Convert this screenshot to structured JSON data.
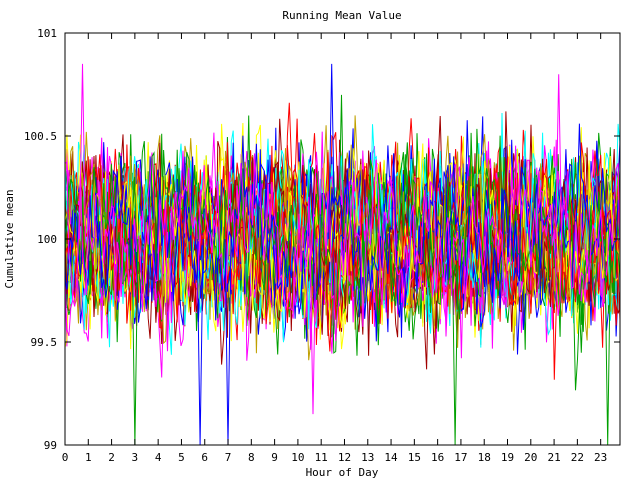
{
  "chart_data": {
    "type": "line",
    "title": "Running Mean Value",
    "xlabel": "Hour of Day",
    "ylabel": "Cumulative mean",
    "xlim": [
      0,
      23.83
    ],
    "ylim": [
      99,
      101
    ],
    "x_ticks": [
      0,
      1,
      2,
      3,
      4,
      5,
      6,
      7,
      8,
      9,
      10,
      11,
      12,
      13,
      14,
      15,
      16,
      17,
      18,
      19,
      20,
      21,
      22,
      23
    ],
    "y_ticks": [
      {
        "value": 99,
        "label": "99"
      },
      {
        "value": 99.5,
        "label": "99.5"
      },
      {
        "value": 100,
        "label": "100"
      },
      {
        "value": 100.5,
        "label": "100.5"
      },
      {
        "value": 101,
        "label": "101"
      }
    ],
    "grid": false,
    "legend": "none",
    "points_per_series": 288,
    "series_colors": [
      "#ff0000",
      "#00a000",
      "#0000ff",
      "#ff00ff",
      "#00ffff",
      "#c0a000",
      "#a00000",
      "#ffff00"
    ],
    "series_count": 60,
    "value_center": 100,
    "value_spread": 0.16,
    "notable_spikes": [
      {
        "color": "#00a000",
        "x": 3.0,
        "y": 99.0
      },
      {
        "color": "#0000ff",
        "x": 5.8,
        "y": 99.0
      },
      {
        "color": "#0000ff",
        "x": 7.0,
        "y": 99.0
      },
      {
        "color": "#00a000",
        "x": 16.75,
        "y": 99.0
      },
      {
        "color": "#00a000",
        "x": 23.3,
        "y": 99.0
      },
      {
        "color": "#ff00ff",
        "x": 0.75,
        "y": 100.85
      },
      {
        "color": "#0000ff",
        "x": 11.45,
        "y": 100.85
      },
      {
        "color": "#ff00ff",
        "x": 21.2,
        "y": 100.8
      },
      {
        "color": "#ff00ff",
        "x": 10.65,
        "y": 99.15
      }
    ]
  }
}
